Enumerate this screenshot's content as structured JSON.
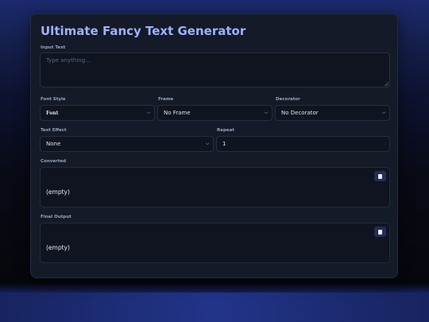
{
  "header": {
    "title": "Ultimate Fancy Text Generator"
  },
  "input": {
    "label": "Input Text",
    "placeholder": "Type anything...",
    "value": ""
  },
  "font_style": {
    "label": "Font Style",
    "selected": "𝐅𝐨𝐧𝐭"
  },
  "frame": {
    "label": "Frame",
    "selected": "No Frame"
  },
  "decorator": {
    "label": "Decorator",
    "selected": "No Decorator"
  },
  "text_effect": {
    "label": "Text Effect",
    "selected": "None"
  },
  "repeat": {
    "label": "Repeat",
    "value": "1"
  },
  "converted": {
    "label": "Converted",
    "text": "(empty)",
    "copy_icon": "copy-icon"
  },
  "final_output": {
    "label": "Final Output",
    "text": "(empty)",
    "copy_icon": "copy-icon"
  },
  "colors": {
    "accent_title": "#9db2ff",
    "card_bg": "#141a27",
    "field_bg": "#0f1420",
    "copy_button_bg": "#262d52"
  }
}
